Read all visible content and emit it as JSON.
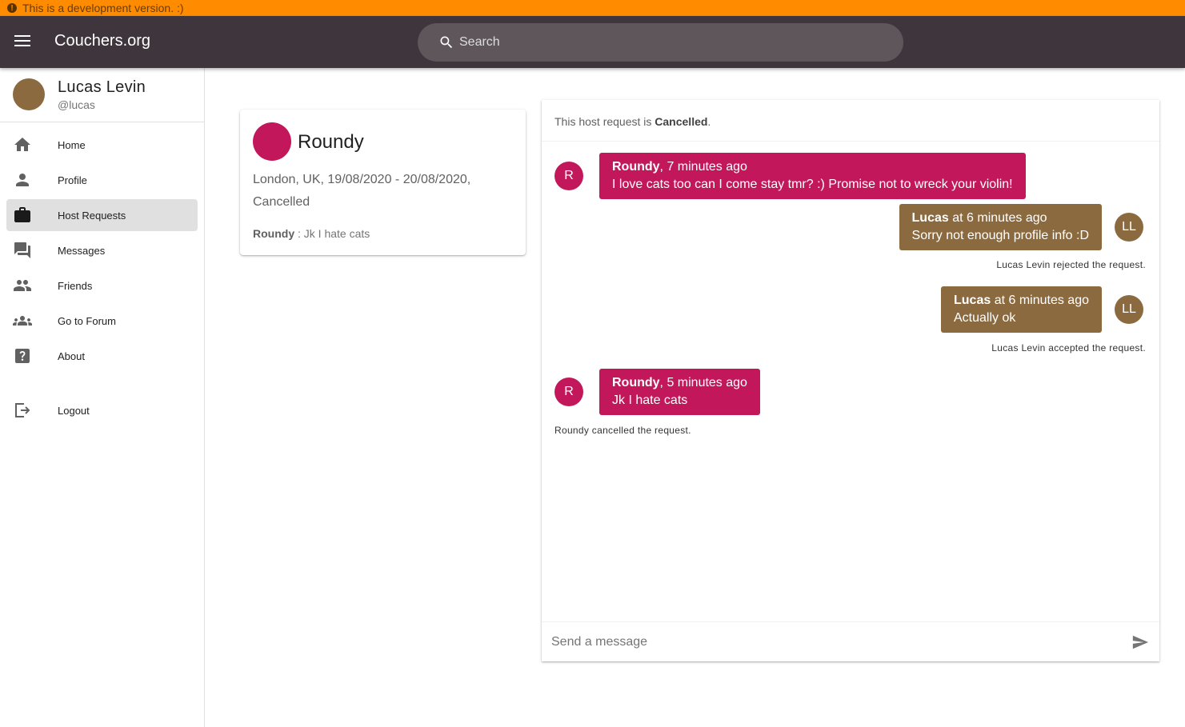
{
  "banner": {
    "text": "This is a development version. :)",
    "icon": "info-icon"
  },
  "appbar": {
    "brand": "Couchers.org",
    "search_placeholder": "Search"
  },
  "user": {
    "name": "Lucas Levin",
    "handle": "@lucas"
  },
  "nav": [
    {
      "label": "Home",
      "icon": "home-icon",
      "active": false
    },
    {
      "label": "Profile",
      "icon": "person-icon",
      "active": false
    },
    {
      "label": "Host Requests",
      "icon": "briefcase-icon",
      "active": true
    },
    {
      "label": "Messages",
      "icon": "forum-icon",
      "active": false
    },
    {
      "label": "Friends",
      "icon": "people-icon",
      "active": false
    },
    {
      "label": "Go to Forum",
      "icon": "groups-icon",
      "active": false
    },
    {
      "label": "About",
      "icon": "help-icon",
      "active": false
    },
    {
      "label": "Logout",
      "icon": "logout-icon",
      "active": false
    }
  ],
  "request_card": {
    "name": "Roundy",
    "details": "London, UK, 19/08/2020 - 20/08/2020, Cancelled",
    "last_sender": "Roundy",
    "last_separator": " : ",
    "last_message": "Jk I hate cats"
  },
  "chat": {
    "status_prefix": "This host request is ",
    "status_value": "Cancelled",
    "status_suffix": ".",
    "messages": [
      {
        "sender": "Roundy",
        "meta": ", 7 minutes ago",
        "text": "I love cats too can I come stay tmr? :) Promise not to wreck your violin!",
        "avatar": "R",
        "side": "left"
      },
      {
        "sender": "Lucas",
        "meta": " at 6 minutes ago",
        "text": "Sorry not enough profile info :D",
        "avatar": "LL",
        "side": "right"
      },
      {
        "sender": "Lucas",
        "meta": " at 6 minutes ago",
        "text": "Actually ok",
        "avatar": "LL",
        "side": "right"
      },
      {
        "sender": "Roundy",
        "meta": ", 5 minutes ago",
        "text": "Jk I hate cats",
        "avatar": "R",
        "side": "left"
      }
    ],
    "events": [
      "Lucas Levin rejected the request.",
      "Lucas Levin accepted the request.",
      "Roundy cancelled the request."
    ],
    "composer_placeholder": "Send a message"
  },
  "colors": {
    "banner": "#ff8c00",
    "appbar": "#3e363c",
    "roundy": "#c2185b",
    "lucas": "#8b6a40"
  }
}
